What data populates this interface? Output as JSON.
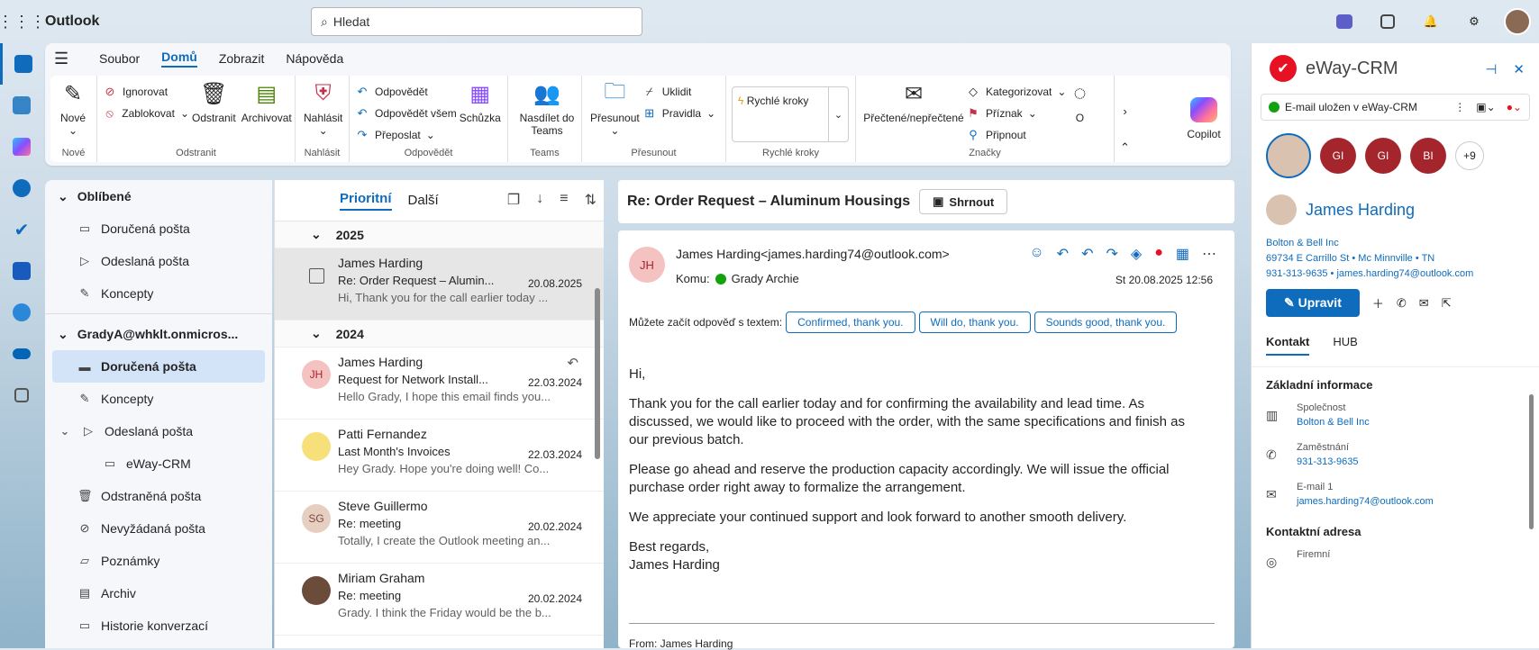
{
  "app": {
    "name": "Outlook"
  },
  "search": {
    "placeholder": "Hledat"
  },
  "ribbon": {
    "tabs": [
      "Soubor",
      "Domů",
      "Zobrazit",
      "Nápověda"
    ],
    "groups": {
      "new": {
        "label": "Nové",
        "button": "Nové"
      },
      "delete": {
        "label": "Odstranit",
        "ignore": "Ignorovat",
        "block": "Zablokovat",
        "delete": "Odstranit",
        "archive": "Archivovat"
      },
      "report": {
        "label": "Nahlásit",
        "button": "Nahlásit"
      },
      "respond": {
        "label": "Odpovědět",
        "reply": "Odpovědět",
        "reply_all": "Odpovědět všem",
        "forward": "Přeposlat",
        "meeting": "Schůzka"
      },
      "teams": {
        "label": "Teams",
        "button": "Nasdílet do Teams"
      },
      "move": {
        "label": "Přesunout",
        "button": "Přesunout",
        "sweep": "Uklidit",
        "rules": "Pravidla"
      },
      "quick": {
        "label": "Rychlé kroky",
        "button": "Rychlé kroky"
      },
      "tags": {
        "label": "Značky",
        "read": "Přečtené/nepřečtené",
        "categorize": "Kategorizovat",
        "flag": "Příznak",
        "pin": "Připnout",
        "more": "O"
      }
    },
    "copilot": "Copilot"
  },
  "folders": {
    "favorites": {
      "label": "Oblíbené",
      "items": [
        "Doručená pošta",
        "Odeslaná pošta",
        "Koncepty"
      ]
    },
    "account": {
      "label": "GradyA@whklt.onmicros...",
      "items": [
        "Doručená pošta",
        "Koncepty",
        "Odeslaná pošta",
        "eWay-CRM",
        "Odstraněná pošta",
        "Nevyžádaná pošta",
        "Poznámky",
        "Archiv",
        "Historie konverzací"
      ]
    }
  },
  "list": {
    "tabs": [
      "Prioritní",
      "Další"
    ],
    "group_2025": "2025",
    "group_2024": "2024",
    "messages": [
      {
        "from": "James Harding",
        "subject": "Re: Order Request – Alumin...",
        "date": "20.08.2025",
        "preview": "Hi, Thank you for the call earlier today ...",
        "initials": ""
      },
      {
        "from": "James Harding",
        "subject": "Request for Network Install...",
        "date": "22.03.2024",
        "preview": "Hello Grady, I hope this email finds you...",
        "initials": "JH"
      },
      {
        "from": "Patti Fernandez",
        "subject": "Last Month's Invoices",
        "date": "22.03.2024",
        "preview": "Hey Grady. Hope you're doing well! Co...",
        "initials": ""
      },
      {
        "from": "Steve Guillermo",
        "subject": "Re: meeting",
        "date": "20.02.2024",
        "preview": "Totally, I create the Outlook meeting an...",
        "initials": "SG"
      },
      {
        "from": "Miriam Graham",
        "subject": "Re: meeting",
        "date": "20.02.2024",
        "preview": "Grady. I think the Friday would be the b...",
        "initials": ""
      }
    ]
  },
  "reading": {
    "subject": "Re: Order Request – Aluminum Housings",
    "summarize": "Shrnout",
    "sender": "James Harding<james.harding74@outlook.com>",
    "sender_initials": "JH",
    "to_label": "Komu:",
    "to": "Grady Archie",
    "date": "St 20.08.2025 12:56",
    "suggest_label": "Můžete začít odpověď s textem:",
    "suggestions": [
      "Confirmed, thank you.",
      "Will do, thank you.",
      "Sounds good, thank you."
    ],
    "body": [
      "Hi,",
      "Thank you for the call earlier today and for confirming the availability and lead time. As discussed, we would like to proceed with the order, with the same specifications and finish as our previous batch.",
      "Please go ahead and reserve the production capacity accordingly. We will issue the official purchase order right away to formalize the arrangement.",
      "We appreciate your continued support and look forward to another smooth delivery.",
      "Best regards,",
      "James Harding"
    ],
    "from_footer": "From: James Harding"
  },
  "eway": {
    "title": "eWay-CRM",
    "status": "E-mail uložen v eWay-CRM",
    "avatars": [
      "GI",
      "GI",
      "BI"
    ],
    "more": "+9",
    "name": "James Harding",
    "company": "Bolton & Bell Inc",
    "address": "69734 E Carrillo St • Mc Minnville • TN",
    "contact_line": "931-313-9635 • james.harding74@outlook.com",
    "edit": "Upravit",
    "tabs": [
      "Kontakt",
      "HUB"
    ],
    "section_basic": "Základní informace",
    "company_label": "Společnost",
    "company_value": "Bolton & Bell Inc",
    "phone_label": "Zaměstnání",
    "phone_value": "931-313-9635",
    "email_label": "E-mail 1",
    "email_value": "james.harding74@outlook.com",
    "section_address": "Kontaktní adresa",
    "firm_label": "Firemní"
  }
}
